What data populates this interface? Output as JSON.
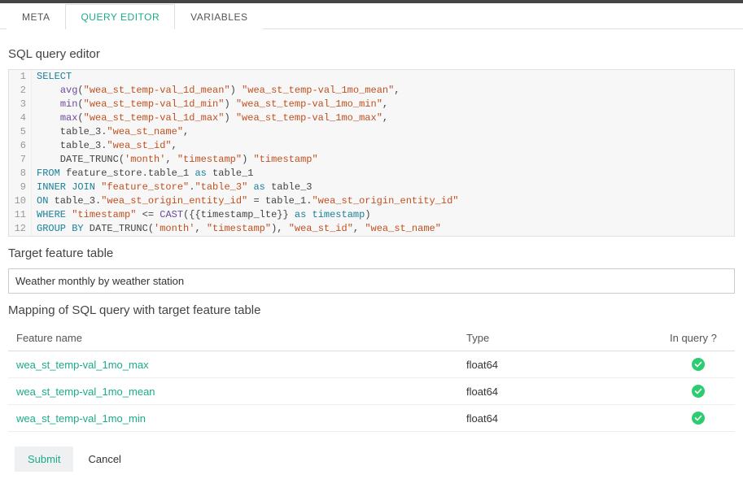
{
  "tabs": {
    "meta": "META",
    "query_editor": "QUERY EDITOR",
    "variables": "VARIABLES"
  },
  "titles": {
    "editor": "SQL query editor",
    "target": "Target feature table",
    "mapping": "Mapping of SQL query with target feature table"
  },
  "sql": [
    [
      {
        "c": "kw",
        "t": "SELECT"
      }
    ],
    [
      {
        "c": "",
        "t": "    "
      },
      {
        "c": "fn",
        "t": "avg"
      },
      {
        "c": "",
        "t": "("
      },
      {
        "c": "str",
        "t": "\"wea_st_temp-val_1d_mean\""
      },
      {
        "c": "",
        "t": ") "
      },
      {
        "c": "str",
        "t": "\"wea_st_temp-val_1mo_mean\""
      },
      {
        "c": "",
        "t": ","
      }
    ],
    [
      {
        "c": "",
        "t": "    "
      },
      {
        "c": "fn",
        "t": "min"
      },
      {
        "c": "",
        "t": "("
      },
      {
        "c": "str",
        "t": "\"wea_st_temp-val_1d_min\""
      },
      {
        "c": "",
        "t": ") "
      },
      {
        "c": "str",
        "t": "\"wea_st_temp-val_1mo_min\""
      },
      {
        "c": "",
        "t": ","
      }
    ],
    [
      {
        "c": "",
        "t": "    "
      },
      {
        "c": "fn",
        "t": "max"
      },
      {
        "c": "",
        "t": "("
      },
      {
        "c": "str",
        "t": "\"wea_st_temp-val_1d_max\""
      },
      {
        "c": "",
        "t": ") "
      },
      {
        "c": "str",
        "t": "\"wea_st_temp-val_1mo_max\""
      },
      {
        "c": "",
        "t": ","
      }
    ],
    [
      {
        "c": "",
        "t": "    table_3."
      },
      {
        "c": "str",
        "t": "\"wea_st_name\""
      },
      {
        "c": "",
        "t": ","
      }
    ],
    [
      {
        "c": "",
        "t": "    table_3."
      },
      {
        "c": "str",
        "t": "\"wea_st_id\""
      },
      {
        "c": "",
        "t": ","
      }
    ],
    [
      {
        "c": "",
        "t": "    DATE_TRUNC("
      },
      {
        "c": "str",
        "t": "'month'"
      },
      {
        "c": "",
        "t": ", "
      },
      {
        "c": "str",
        "t": "\"timestamp\""
      },
      {
        "c": "",
        "t": ") "
      },
      {
        "c": "str",
        "t": "\"timestamp\""
      }
    ],
    [
      {
        "c": "kw",
        "t": "FROM"
      },
      {
        "c": "",
        "t": " feature_store.table_1 "
      },
      {
        "c": "kw",
        "t": "as"
      },
      {
        "c": "",
        "t": " table_1"
      }
    ],
    [
      {
        "c": "kw",
        "t": "INNER JOIN"
      },
      {
        "c": "",
        "t": " "
      },
      {
        "c": "str",
        "t": "\"feature_store\""
      },
      {
        "c": "",
        "t": "."
      },
      {
        "c": "str",
        "t": "\"table_3\""
      },
      {
        "c": "",
        "t": " "
      },
      {
        "c": "kw",
        "t": "as"
      },
      {
        "c": "",
        "t": " table_3"
      }
    ],
    [
      {
        "c": "kw",
        "t": "ON"
      },
      {
        "c": "",
        "t": " table_3."
      },
      {
        "c": "str",
        "t": "\"wea_st_origin_entity_id\""
      },
      {
        "c": "",
        "t": " = table_1."
      },
      {
        "c": "str",
        "t": "\"wea_st_origin_entity_id\""
      }
    ],
    [
      {
        "c": "kw",
        "t": "WHERE"
      },
      {
        "c": "",
        "t": " "
      },
      {
        "c": "str",
        "t": "\"timestamp\""
      },
      {
        "c": "",
        "t": " <= "
      },
      {
        "c": "fn",
        "t": "CAST"
      },
      {
        "c": "",
        "t": "({{timestamp_lte}} "
      },
      {
        "c": "kw",
        "t": "as"
      },
      {
        "c": "",
        "t": " "
      },
      {
        "c": "kw",
        "t": "timestamp"
      },
      {
        "c": "",
        "t": ")"
      }
    ],
    [
      {
        "c": "kw",
        "t": "GROUP BY"
      },
      {
        "c": "",
        "t": " DATE_TRUNC("
      },
      {
        "c": "str",
        "t": "'month'"
      },
      {
        "c": "",
        "t": ", "
      },
      {
        "c": "str",
        "t": "\"timestamp\""
      },
      {
        "c": "",
        "t": "), "
      },
      {
        "c": "str",
        "t": "\"wea_st_id\""
      },
      {
        "c": "",
        "t": ", "
      },
      {
        "c": "str",
        "t": "\"wea_st_name\""
      }
    ]
  ],
  "target_value": "Weather monthly by weather station",
  "mapping": {
    "headers": {
      "feature": "Feature name",
      "type": "Type",
      "in_query": "In query ?"
    },
    "rows": [
      {
        "feature": "wea_st_temp-val_1mo_max",
        "type": "float64",
        "in_query": true
      },
      {
        "feature": "wea_st_temp-val_1mo_mean",
        "type": "float64",
        "in_query": true
      },
      {
        "feature": "wea_st_temp-val_1mo_min",
        "type": "float64",
        "in_query": true
      }
    ]
  },
  "actions": {
    "submit": "Submit",
    "cancel": "Cancel"
  }
}
